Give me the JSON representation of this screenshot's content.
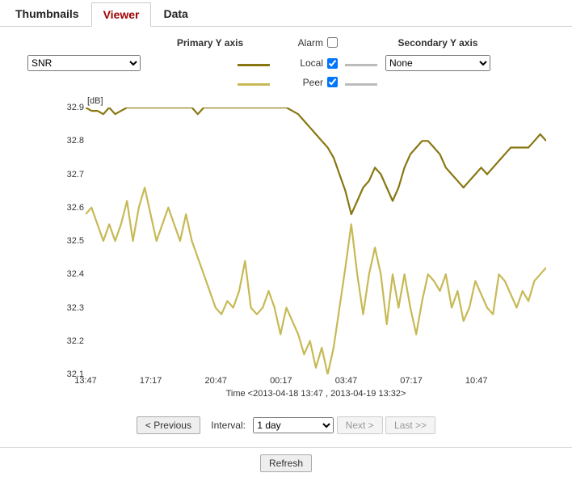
{
  "tabs": {
    "thumbnails": "Thumbnails",
    "viewer": "Viewer",
    "data": "Data",
    "active": "viewer"
  },
  "controls": {
    "primary_axis_label": "Primary Y axis",
    "secondary_axis_label": "Secondary Y axis",
    "alarm_label": "Alarm",
    "local_label": "Local",
    "peer_label": "Peer",
    "primary_select": {
      "value": "SNR",
      "options": [
        "SNR"
      ]
    },
    "secondary_select": {
      "value": "None",
      "options": [
        "None"
      ]
    },
    "alarm_checked": false,
    "local_checked": true,
    "peer_checked": true
  },
  "nav": {
    "prev": "< Previous",
    "interval_label": "Interval:",
    "interval_select": {
      "value": "1 day",
      "options": [
        "1 day"
      ]
    },
    "next": "Next >",
    "last": "Last >>",
    "refresh": "Refresh"
  },
  "chart_data": {
    "type": "line",
    "title": "",
    "ylabel_unit": "[dB]",
    "xlabel": "Time  <2013-04-18 13:47 ,  2013-04-19 13:32>",
    "ylim": [
      32.1,
      32.9
    ],
    "xticks": [
      "13:47",
      "17:17",
      "20:47",
      "00:17",
      "03:47",
      "07:17",
      "10:47"
    ],
    "series": [
      {
        "name": "Local",
        "color": "#887711",
        "values": [
          32.9,
          32.89,
          32.89,
          32.88,
          32.9,
          32.88,
          32.89,
          32.9,
          32.9,
          32.9,
          32.9,
          32.9,
          32.9,
          32.9,
          32.9,
          32.9,
          32.9,
          32.9,
          32.9,
          32.88,
          32.9,
          32.9,
          32.9,
          32.9,
          32.9,
          32.9,
          32.9,
          32.9,
          32.9,
          32.9,
          32.9,
          32.9,
          32.9,
          32.9,
          32.9,
          32.89,
          32.88,
          32.86,
          32.84,
          32.82,
          32.8,
          32.78,
          32.75,
          32.7,
          32.65,
          32.58,
          32.62,
          32.66,
          32.68,
          32.72,
          32.7,
          32.66,
          32.62,
          32.66,
          32.72,
          32.76,
          32.78,
          32.8,
          32.8,
          32.78,
          32.76,
          32.72,
          32.7,
          32.68,
          32.66,
          32.68,
          32.7,
          32.72,
          32.7,
          32.72,
          32.74,
          32.76,
          32.78,
          32.78,
          32.78,
          32.78,
          32.8,
          32.82,
          32.8
        ]
      },
      {
        "name": "Peer",
        "color": "#c7b955",
        "values": [
          32.58,
          32.6,
          32.55,
          32.5,
          32.55,
          32.5,
          32.55,
          32.62,
          32.5,
          32.6,
          32.66,
          32.58,
          32.5,
          32.55,
          32.6,
          32.55,
          32.5,
          32.58,
          32.5,
          32.45,
          32.4,
          32.35,
          32.3,
          32.28,
          32.32,
          32.3,
          32.35,
          32.44,
          32.3,
          32.28,
          32.3,
          32.35,
          32.3,
          32.22,
          32.3,
          32.26,
          32.22,
          32.16,
          32.2,
          32.12,
          32.18,
          32.1,
          32.18,
          32.3,
          32.42,
          32.55,
          32.4,
          32.28,
          32.4,
          32.48,
          32.4,
          32.25,
          32.4,
          32.3,
          32.4,
          32.3,
          32.22,
          32.32,
          32.4,
          32.38,
          32.35,
          32.4,
          32.3,
          32.35,
          32.26,
          32.3,
          32.38,
          32.34,
          32.3,
          32.28,
          32.4,
          32.38,
          32.34,
          32.3,
          32.35,
          32.32,
          32.38,
          32.4,
          32.42
        ]
      }
    ],
    "colors": {
      "local": "#887711",
      "peer": "#c7b955",
      "secondary": "#bbb"
    }
  }
}
